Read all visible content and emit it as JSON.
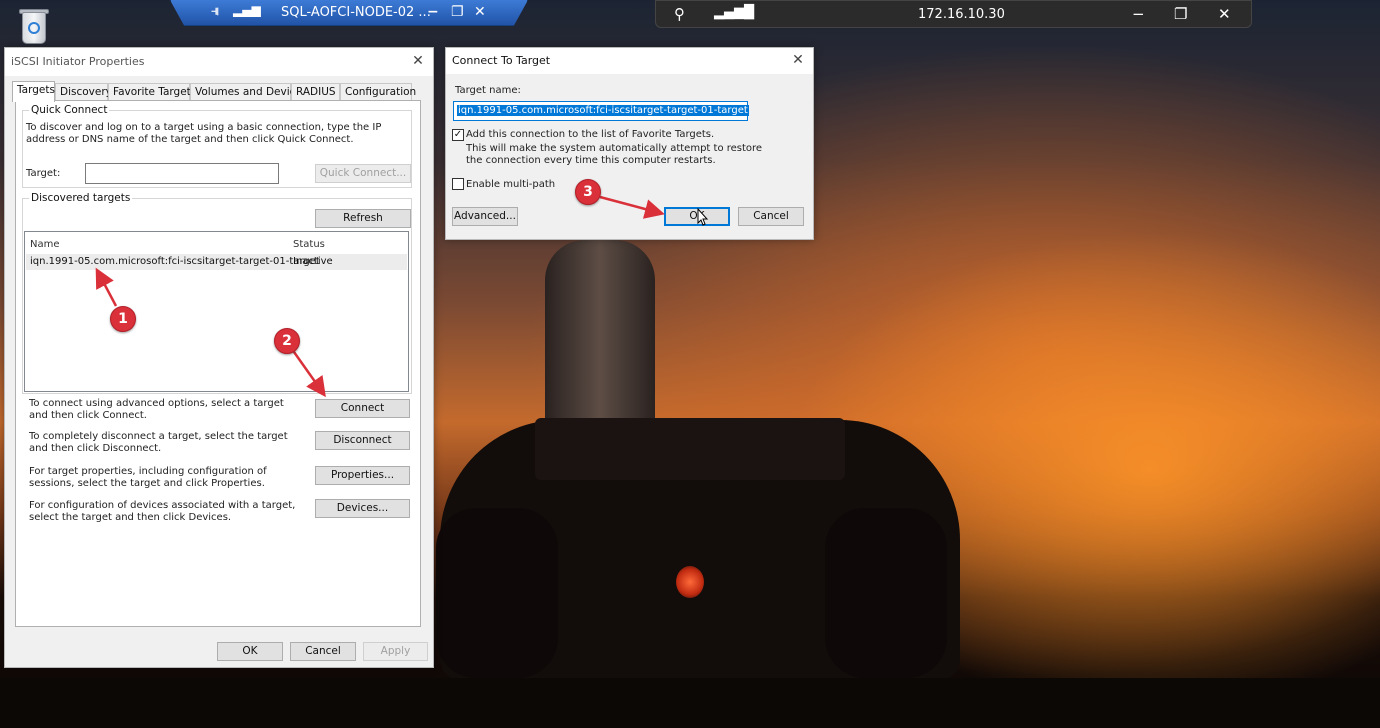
{
  "rdp_bar": {
    "title": "SQL-AOFCI-NODE-02 ...",
    "minimize": "−",
    "restore": "❐",
    "close": "✕"
  },
  "connection_bar": {
    "ip": "172.16.10.30",
    "minimize": "−",
    "restore": "❐",
    "close": "✕"
  },
  "iscsi": {
    "title": "iSCSI Initiator Properties",
    "tabs": [
      "Targets",
      "Discovery",
      "Favorite Targets",
      "Volumes and Devices",
      "RADIUS",
      "Configuration"
    ],
    "quick_connect": {
      "label": "Quick Connect",
      "desc": "To discover and log on to a target using a basic connection, type the IP address or DNS name of the target and then click Quick Connect.",
      "target_label": "Target:",
      "target_value": "",
      "button": "Quick Connect..."
    },
    "discovered": {
      "label": "Discovered targets",
      "refresh": "Refresh",
      "columns": [
        "Name",
        "Status"
      ],
      "rows": [
        {
          "name": "iqn.1991-05.com.microsoft:fci-iscsitarget-target-01-target",
          "status": "Inactive"
        }
      ]
    },
    "actions": [
      {
        "desc": "To connect using advanced options, select a target and then click Connect.",
        "button": "Connect"
      },
      {
        "desc": "To completely disconnect a target, select the target and then click Disconnect.",
        "button": "Disconnect"
      },
      {
        "desc": "For target properties, including configuration of sessions, select the target and click Properties.",
        "button": "Properties..."
      },
      {
        "desc": "For configuration of devices associated with a target, select the target and then click Devices.",
        "button": "Devices..."
      }
    ],
    "footer": {
      "ok": "OK",
      "cancel": "Cancel",
      "apply": "Apply"
    }
  },
  "connect": {
    "title": "Connect To Target",
    "target_name_label": "Target name:",
    "target_name_value": "iqn.1991-05.com.microsoft:fci-iscsitarget-target-01-target",
    "favorite_checkbox": "Add this connection to the list of Favorite Targets.",
    "favorite_desc": "This will make the system automatically attempt to restore the connection every time this computer restarts.",
    "favorite_checked": true,
    "multipath_checkbox": "Enable multi-path",
    "multipath_checked": false,
    "advanced": "Advanced...",
    "ok": "OK",
    "cancel": "Cancel"
  },
  "annotations": {
    "badge_1": "1",
    "badge_2": "2",
    "badge_3": "3",
    "color": "#d9303a"
  }
}
